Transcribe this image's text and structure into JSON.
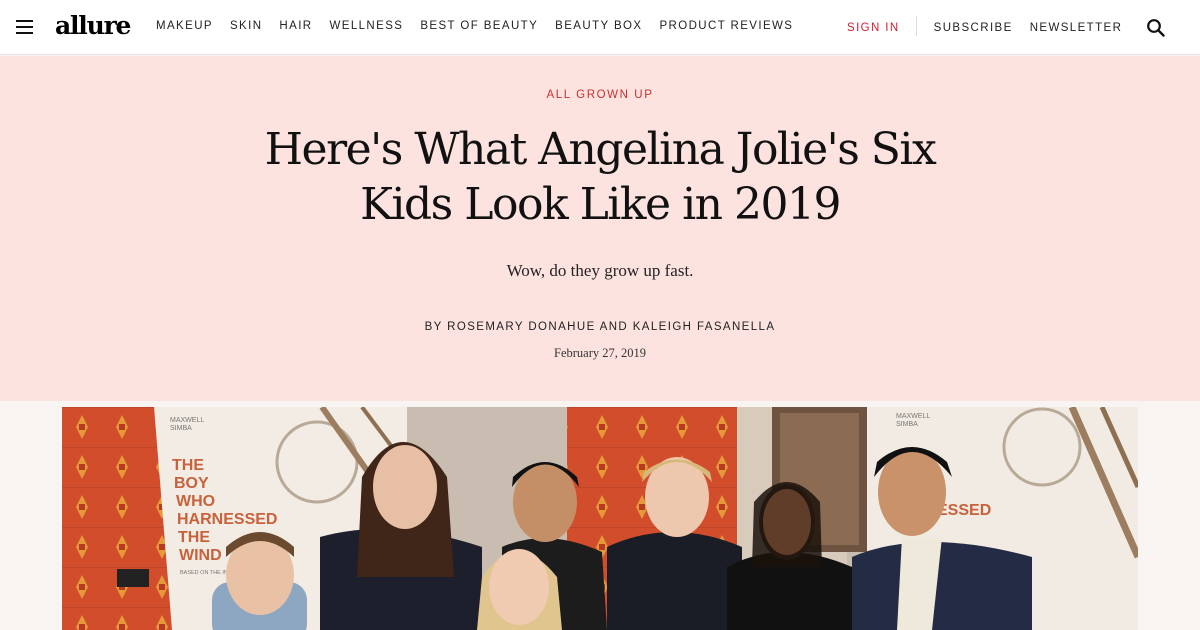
{
  "header": {
    "logo": "allure",
    "nav": [
      "MAKEUP",
      "SKIN",
      "HAIR",
      "WELLNESS",
      "BEST OF BEAUTY",
      "BEAUTY BOX",
      "PRODUCT REVIEWS"
    ],
    "sign_in": "SIGN IN",
    "subscribe": "SUBSCRIBE",
    "newsletter": "NEWSLETTER"
  },
  "article": {
    "kicker": "ALL GROWN UP",
    "headline_line1": "Here's What Angelina Jolie's Six",
    "headline_line2": "Kids Look Like in 2019",
    "dek": "Wow, do they grow up fast.",
    "byline_prefix": "BY",
    "author1": "ROSEMARY DONAHUE",
    "byline_and": "AND",
    "author2": "KALEIGH FASANELLA",
    "date": "February 27, 2019"
  },
  "photo": {
    "poster_left_title": [
      "THE",
      "BOY",
      "WHO",
      "HARNESSED",
      "THE",
      "WIND"
    ],
    "poster_left_credit": [
      "MAXWELL",
      "SIMBA"
    ],
    "poster_left_small": "BASED ON THE INCREDIBLE T",
    "poster_right_title": "ESSED",
    "poster_right_credit": [
      "MAXWELL",
      "SIMBA"
    ]
  },
  "colors": {
    "hero_background": "#fde3e0",
    "accent_red": "#c8302e",
    "sign_in_red": "#d0202e"
  }
}
